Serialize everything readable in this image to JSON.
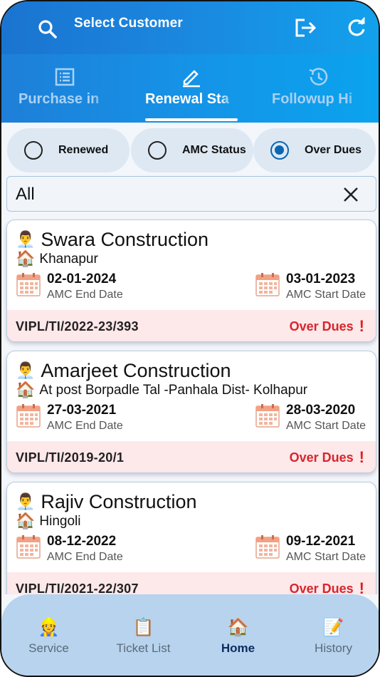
{
  "header": {
    "title": "Select Customer",
    "search_icon": "search-icon",
    "logout_icon": "logout-icon",
    "refresh_icon": "refresh-icon"
  },
  "tabs": [
    {
      "label": "Purchase in",
      "icon": "list-icon"
    },
    {
      "label": "Renewal Sta",
      "icon": "edit-icon",
      "selected": true
    },
    {
      "label": "Followup Hi",
      "icon": "history-icon"
    }
  ],
  "filters": {
    "options": [
      {
        "label": "Renewed",
        "checked": false
      },
      {
        "label": "AMC Status",
        "checked": false
      },
      {
        "label": "Over Dues",
        "checked": true
      }
    ],
    "search_value": "All"
  },
  "customers": [
    {
      "name": "Swara Construction",
      "location": "Khanapur",
      "end_date": "02-01-2024",
      "end_label": "AMC End Date",
      "start_date": "03-01-2023",
      "start_label": "AMC Start Date",
      "ref": "VIPL/TI/2022-23/393",
      "status": "Over Dues",
      "status_icon": "!"
    },
    {
      "name": "Amarjeet Construction",
      "location": "At post Borpadle Tal -Panhala Dist- Kolhapur",
      "end_date": "27-03-2021",
      "end_label": "AMC End Date",
      "start_date": "28-03-2020",
      "start_label": "AMC Start Date",
      "ref": "VIPL/TI/2019-20/1",
      "status": "Over Dues",
      "status_icon": "!"
    },
    {
      "name": "Rajiv Construction",
      "location": "Hingoli",
      "end_date": "08-12-2022",
      "end_label": "AMC End Date",
      "start_date": "09-12-2021",
      "start_label": "AMC Start Date",
      "ref": "VIPL/TI/2021-22/307",
      "status": "Over Dues",
      "status_icon": "!"
    }
  ],
  "bottom_nav": [
    {
      "label": "Service",
      "icon": "👷"
    },
    {
      "label": "Ticket List",
      "icon": "📋"
    },
    {
      "label": "Home",
      "icon": "🏠",
      "selected": true
    },
    {
      "label": "History",
      "icon": "📝"
    }
  ],
  "colors": {
    "header_start": "#1e7fd8",
    "header_end": "#0aa3ee",
    "overdue_red": "#d7262b",
    "footer_pink": "#fde8ea",
    "nav_bg": "#b7d3ee"
  }
}
